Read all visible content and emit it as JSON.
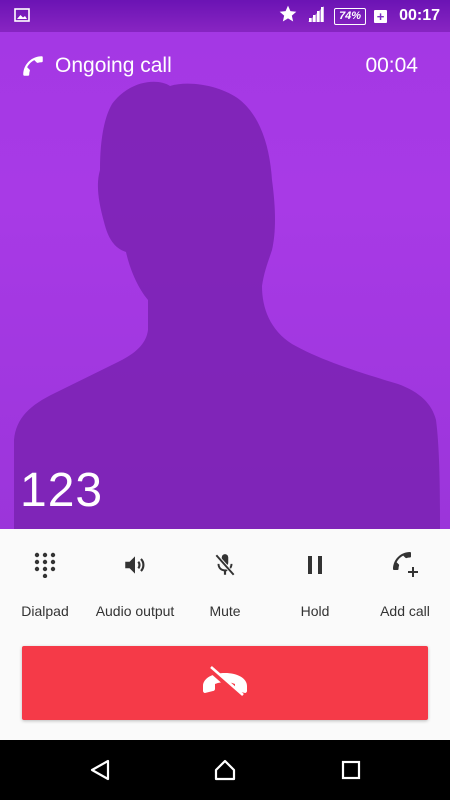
{
  "status_bar": {
    "time": "00:17",
    "battery_percent": "74%",
    "battery_plus": "+",
    "icons": [
      "image-notification-icon",
      "star-icon",
      "signal-icon",
      "battery-icon"
    ]
  },
  "call": {
    "title": "Ongoing call",
    "timer": "00:04",
    "number": "123"
  },
  "actions": [
    {
      "label": "Dialpad",
      "icon": "dialpad-icon"
    },
    {
      "label": "Audio output",
      "icon": "speaker-icon"
    },
    {
      "label": "Mute",
      "icon": "mic-off-icon"
    },
    {
      "label": "Hold",
      "icon": "pause-icon"
    },
    {
      "label": "Add call",
      "icon": "add-call-icon"
    }
  ],
  "end_call": {
    "icon": "hang-up-icon",
    "color": "#f53a48"
  },
  "navigation": {
    "items": [
      "back-icon",
      "home-icon",
      "recents-icon"
    ]
  },
  "colors": {
    "hero": "#a83ae6",
    "end_call": "#f53a48",
    "controls_bg": "#fafafa"
  }
}
